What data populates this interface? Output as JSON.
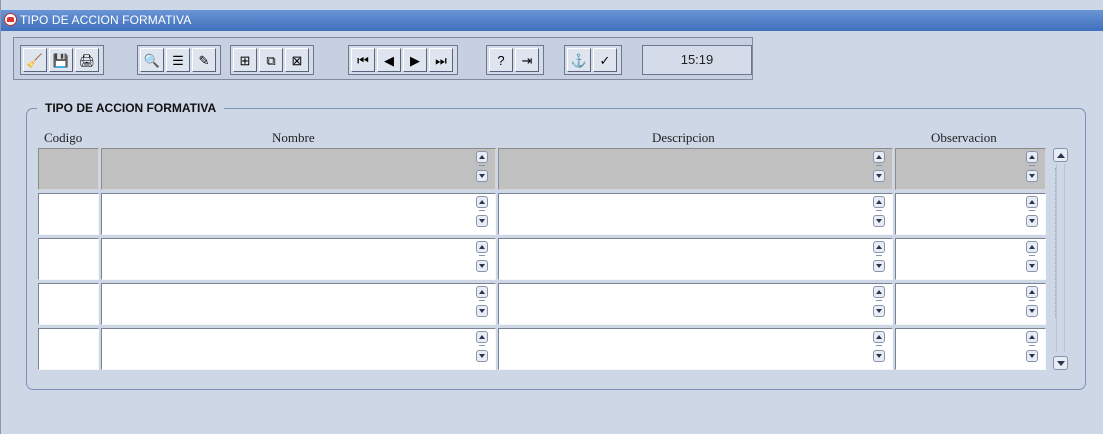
{
  "window": {
    "title": "TIPO DE ACCION FORMATIVA"
  },
  "toolbar": {
    "clock": "15:19",
    "buttons": [
      {
        "name": "clear-icon",
        "glyph": "🧹"
      },
      {
        "name": "save-icon",
        "glyph": "💾"
      },
      {
        "name": "print-icon",
        "glyph": "🖨"
      },
      {
        "name": "query-icon",
        "glyph": "🔍"
      },
      {
        "name": "list-icon",
        "glyph": "☰"
      },
      {
        "name": "edit-icon",
        "glyph": "✎"
      },
      {
        "name": "insert-record-icon",
        "glyph": "⊞"
      },
      {
        "name": "duplicate-record-icon",
        "glyph": "⧉"
      },
      {
        "name": "delete-record-icon",
        "glyph": "⊠"
      },
      {
        "name": "first-record-icon",
        "glyph": "⏮"
      },
      {
        "name": "previous-record-icon",
        "glyph": "◀"
      },
      {
        "name": "next-record-icon",
        "glyph": "▶"
      },
      {
        "name": "last-record-icon",
        "glyph": "⏭"
      },
      {
        "name": "help-icon",
        "glyph": "?"
      },
      {
        "name": "exit-icon",
        "glyph": "⇥"
      },
      {
        "name": "attach-icon",
        "glyph": "⚓"
      },
      {
        "name": "check-icon",
        "glyph": "✓"
      }
    ]
  },
  "form": {
    "frame_title": "TIPO DE ACCION FORMATIVA",
    "columns": {
      "codigo": "Codigo",
      "nombre": "Nombre",
      "descripcion": "Descripcion",
      "observacion": "Observacion"
    },
    "rows": [
      {
        "codigo": "",
        "nombre": "",
        "descripcion": "",
        "observacion": ""
      },
      {
        "codigo": "",
        "nombre": "",
        "descripcion": "",
        "observacion": ""
      },
      {
        "codigo": "",
        "nombre": "",
        "descripcion": "",
        "observacion": ""
      },
      {
        "codigo": "",
        "nombre": "",
        "descripcion": "",
        "observacion": ""
      },
      {
        "codigo": "",
        "nombre": "",
        "descripcion": "",
        "observacion": ""
      }
    ]
  },
  "colors": {
    "titlebar": "#4f7fc6",
    "background": "#cdd7e6",
    "current_row": "#c0c0c0",
    "field": "#ffffff"
  }
}
